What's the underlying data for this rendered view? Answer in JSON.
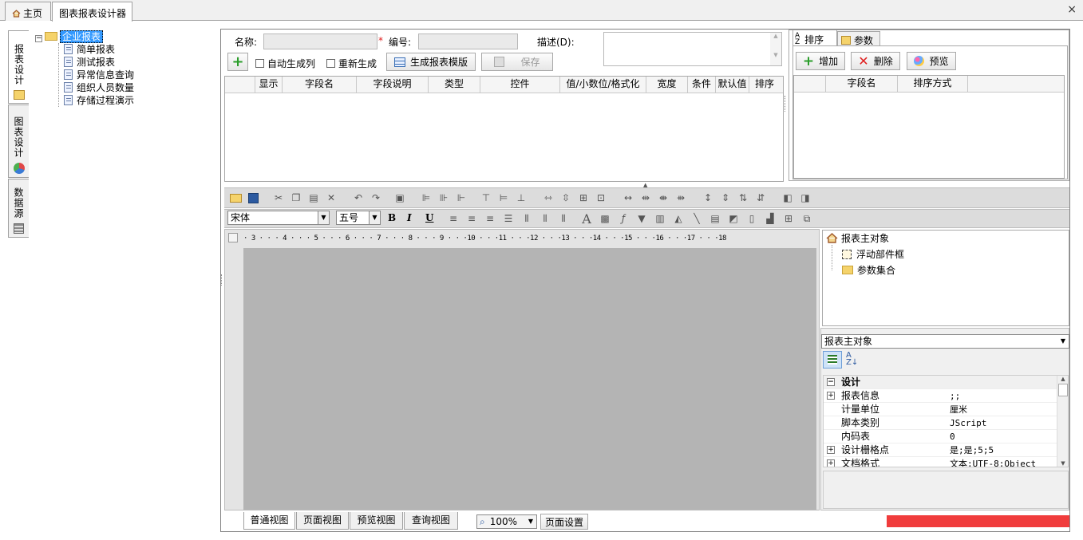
{
  "tabs": [
    {
      "label": "主页",
      "icon": "home-icon"
    },
    {
      "label": "图表报表设计器"
    }
  ],
  "close_label": "×",
  "side_tabs": [
    {
      "label": "报表设计",
      "icon": "report-design-icon"
    },
    {
      "label": "图表设计",
      "icon": "pie-chart-icon"
    },
    {
      "label": "数据源",
      "icon": "database-icon"
    }
  ],
  "tree": {
    "root": "企业报表",
    "items": [
      "简单报表",
      "测试报表",
      "异常信息查询",
      "组织人员数量",
      "存储过程演示"
    ]
  },
  "form": {
    "name_label": "名称:",
    "required_mark": "*",
    "code_label": "编号:",
    "desc_label": "描述(D):",
    "name_value": "",
    "code_value": "",
    "desc_value": "",
    "auto_gen_label": "自动生成列",
    "regen_label": "重新生成",
    "gen_template_label": "生成报表模版",
    "save_label": "保存"
  },
  "field_grid": {
    "columns": [
      "",
      "显示",
      "字段名",
      "字段说明",
      "类型",
      "控件",
      "值/小数位/格式化",
      "宽度",
      "条件",
      "默认值",
      "排序"
    ]
  },
  "right_panel": {
    "tabs": [
      "排序",
      "参数"
    ],
    "add_label": "增加",
    "delete_label": "删除",
    "preview_label": "预览",
    "columns": [
      "",
      "字段名",
      "排序方式"
    ]
  },
  "format_bar": {
    "font": "宋体",
    "size": "五号",
    "bold": "B",
    "italic": "I",
    "underline": "U"
  },
  "ruler_text": "· 3 · · · 4 · · · 5 · · · 6 · · · 7 · · · 8 · · · 9 · · ·10 · · ·11 · · ·12 · · ·13 · · ·14 · · ·15 · · ·16 · · ·17 · · ·18 ·",
  "object_tree": {
    "root": "报表主对象",
    "children": [
      "浮动部件框",
      "参数集合"
    ]
  },
  "property_panel": {
    "selected_object": "报表主对象",
    "category": "设计",
    "rows": [
      {
        "name": "报表信息",
        "value": ";;",
        "expandable": true
      },
      {
        "name": "计量单位",
        "value": "厘米",
        "expandable": false
      },
      {
        "name": "脚本类别",
        "value": "JScript",
        "expandable": false
      },
      {
        "name": "内码表",
        "value": "0",
        "expandable": false
      },
      {
        "name": "设计栅格点",
        "value": "是;是;5;5",
        "expandable": true
      },
      {
        "name": "文档格式",
        "value": "文本;UTF-8;Object",
        "expandable": true
      }
    ]
  },
  "bottom_tabs": [
    "普通视图",
    "页面视图",
    "预览视图",
    "查询视图"
  ],
  "zoom": "100%",
  "page_setup_label": "页面设置",
  "colors": {
    "status_red": "#f03c3c",
    "canvas_gray": "#b4b4b4",
    "selected_blue": "#3399ff"
  }
}
